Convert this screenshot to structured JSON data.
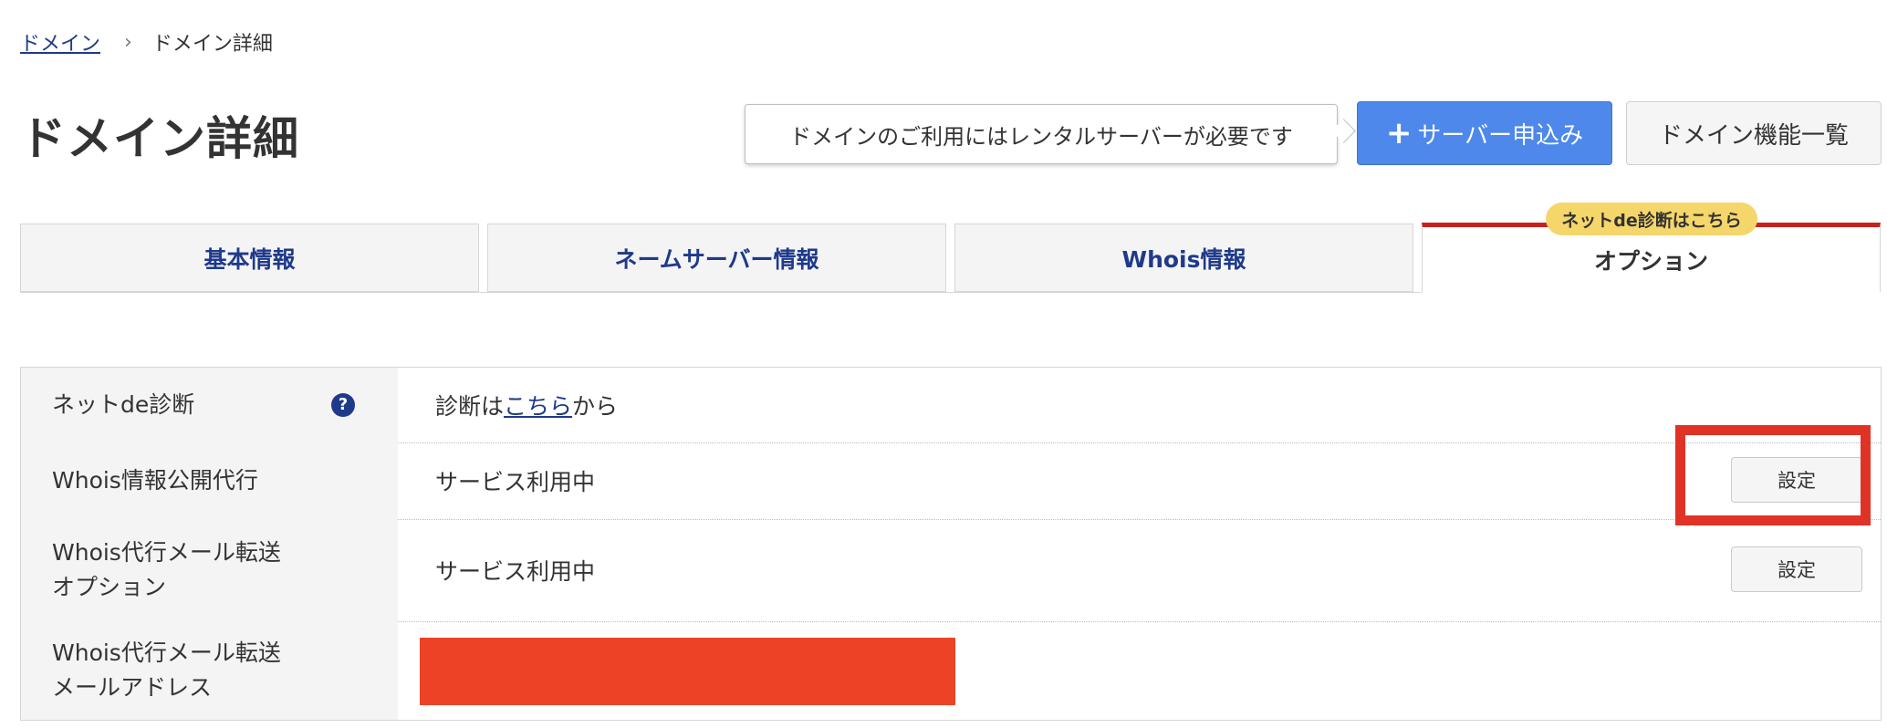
{
  "breadcrumb": {
    "link": "ドメイン",
    "separator": "›",
    "current": "ドメイン詳細"
  },
  "title": "ドメイン詳細",
  "notice": "ドメインのご利用にはレンタルサーバーが必要です",
  "buttons": {
    "apply_icon": "+",
    "apply": "サーバー申込み",
    "list": "ドメイン機能一覧"
  },
  "tabs": [
    {
      "label": "基本情報"
    },
    {
      "label": "ネームサーバー情報"
    },
    {
      "label": "Whois情報"
    },
    {
      "label": "オプション"
    }
  ],
  "tab_badge": "ネットde診断はこちら",
  "rows": [
    {
      "label": "ネットde診断",
      "help": "?",
      "value_prefix": "診断は",
      "value_link": "こちら",
      "value_suffix": "から"
    },
    {
      "label": "Whois情報公開代行",
      "value": "サービス利用中",
      "button": "設定"
    },
    {
      "label_line1": "Whois代行メール転送",
      "label_line2": "オプション",
      "value": "サービス利用中",
      "button": "設定"
    },
    {
      "label_line1": "Whois代行メール転送",
      "label_line2": "メールアドレス"
    }
  ],
  "colors": {
    "accent_blue": "#4d88ea",
    "link_navy": "#1f3a8a",
    "active_tab_red": "#c9201c",
    "badge_yellow": "#f5d66b",
    "highlight_red": "#e13325",
    "redaction_red": "#ed4226"
  }
}
